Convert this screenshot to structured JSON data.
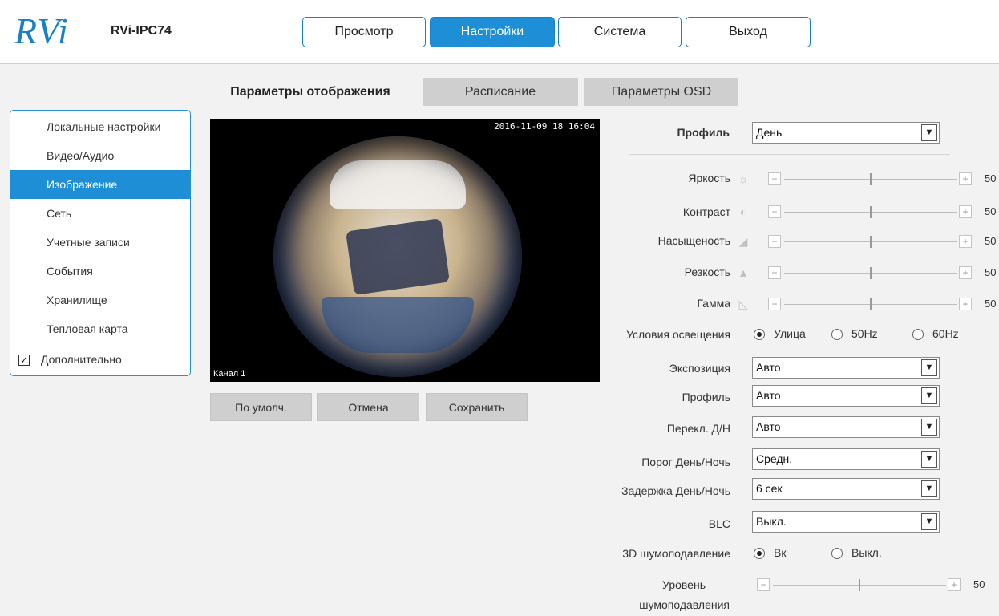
{
  "header": {
    "logo": "RVi",
    "model": "RVi-IPC74",
    "nav": [
      "Просмотр",
      "Настройки",
      "Система",
      "Выход"
    ],
    "active_nav": "Настройки"
  },
  "sidebar": {
    "items": [
      "Локальные настройки",
      "Видео/Аудио",
      "Изображение",
      "Сеть",
      "Учетные записи",
      "События",
      "Хранилище",
      "Тепловая карта"
    ],
    "active_item": "Изображение",
    "advanced": {
      "label": "Дополнительно",
      "checked": true,
      "check_mark": "✓"
    }
  },
  "tabs": [
    "Параметры отображения",
    "Расписание",
    "Параметры OSD"
  ],
  "preview": {
    "timestamp": "2016-11-09 18 16:04",
    "channel": "Канал 1"
  },
  "actions": [
    "По умолч.",
    "Отмена",
    "Сохранить"
  ],
  "form": {
    "profile_label": "Профиль",
    "profile_value": "День",
    "sliders": [
      {
        "label": "Яркость",
        "icon": "sun-icon",
        "value": "50"
      },
      {
        "label": "Контраст",
        "icon": "contrast-icon",
        "value": "50"
      },
      {
        "label": "Насыщеность",
        "icon": "saturation-icon",
        "value": "50"
      },
      {
        "label": "Резкость",
        "icon": "sharpness-icon",
        "value": "50"
      },
      {
        "label": "Гамма",
        "icon": "gamma-icon",
        "value": "50"
      }
    ],
    "lighting": {
      "label": "Условия освещения",
      "options": [
        "Улица",
        "50Hz",
        "60Hz"
      ],
      "selected": "Улица"
    },
    "selects": [
      {
        "label": "Экспозиция",
        "value": "Авто"
      },
      {
        "label": "Профиль",
        "value": "Авто"
      },
      {
        "label": "Перекл. Д/Н",
        "value": "Авто"
      },
      {
        "label": "Порог День/Ночь",
        "value": "Средн."
      },
      {
        "label": "Задержка День/Ночь",
        "value": "6 сек"
      },
      {
        "label": "BLC",
        "value": "Выкл."
      }
    ],
    "dnr": {
      "label": "3D шумоподавление",
      "options": [
        "Вк",
        "Выкл."
      ],
      "selected": "Вк"
    },
    "dnr_level": {
      "label_line1": "Уровень",
      "label_line2": "шумоподавления",
      "value": "50"
    },
    "minus_symbol": "−",
    "plus_symbol": "+",
    "dropdown_arrow": "▼"
  }
}
